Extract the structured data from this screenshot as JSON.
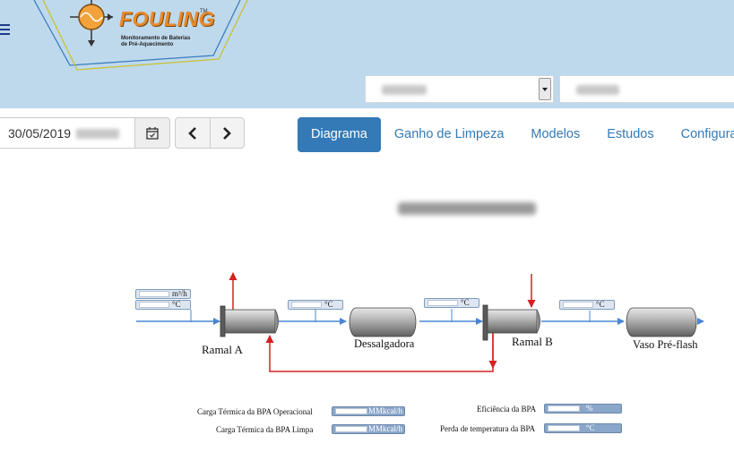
{
  "header": {
    "brand": "FOULING",
    "trademark": "TM",
    "subtitle_line1": "Monitoramento de Baterias",
    "subtitle_line2": "de Pré-Aquecimento",
    "colors": {
      "topbar": "#bfd9ec",
      "brand": "#e8892b",
      "accent": "#337ab7"
    }
  },
  "toolbar": {
    "date": "30/05/2019",
    "calendar_icon": "calendar-icon",
    "prev_icon": "chevron-left-icon",
    "next_icon": "chevron-right-icon"
  },
  "tabs": [
    {
      "label": "Diagrama",
      "active": true
    },
    {
      "label": "Ganho de Limpeza",
      "active": false
    },
    {
      "label": "Modelos",
      "active": false
    },
    {
      "label": "Estudos",
      "active": false
    },
    {
      "label": "Configura",
      "active": false
    }
  ],
  "diagram": {
    "equipment": {
      "ramal_a": "Ramal A",
      "dessalgadora": "Dessalgadora",
      "ramal_b": "Ramal B",
      "vaso": "Vaso Pré-flash"
    },
    "inlet": {
      "flow_unit": "m³/h",
      "temp_unit": "°C"
    },
    "stream_temp_unit": "°C",
    "kpis": {
      "carga_operacional_label": "Carga Térmica da BPA Operacional",
      "carga_operacional_unit": "MMkcal/h",
      "carga_limpa_label": "Carga Térmica da BPA Limpa",
      "carga_limpa_unit": "MMkcal/h",
      "eficiencia_label": "Eficiência da BPA",
      "eficiencia_unit": "%",
      "perda_label": "Perda de temperatura da BPA",
      "perda_unit": "°C"
    }
  }
}
